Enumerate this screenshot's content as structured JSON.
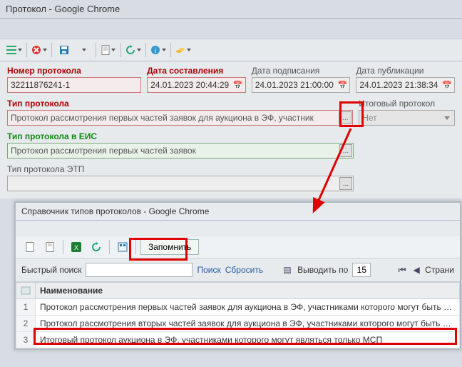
{
  "window_title": "Протокол - Google Chrome",
  "toolbar_icons": [
    "menu",
    "close",
    "save",
    "save-dd",
    "doc",
    "doc-dd",
    "refresh",
    "info",
    "info-dd",
    "coins",
    "coins-dd"
  ],
  "labels": {
    "number": "Номер протокола",
    "date_created": "Дата составления",
    "date_signed": "Дата подписания",
    "date_published": "Дата публикации",
    "type": "Тип протокола",
    "final": "Итоговый протокол",
    "type_eis": "Тип протокола в ЕИС",
    "type_etp": "Тип протокола ЭТП"
  },
  "values": {
    "number": "32211876241-1",
    "date_created": "24.01.2023 20:44:29",
    "date_signed": "24.01.2023 21:00:00",
    "date_published": "24.01.2023 21:38:34",
    "type": "Протокол рассмотрения первых частей заявок для аукциона в ЭФ, участник",
    "type_eis": "Протокол рассмотрения первых частей заявок",
    "type_etp": "",
    "final": "Нет"
  },
  "modal": {
    "title": "Справочник типов протоколов - Google Chrome",
    "remember": "Запомнить",
    "quick_search_label": "Быстрый поиск",
    "search": "Поиск",
    "reset": "Сбросить",
    "show_by": "Выводить по",
    "page_size": "15",
    "page_label": "Страни",
    "header_name": "Наименование",
    "rows": [
      {
        "n": "1",
        "name": "Протокол рассмотрения первых частей заявок для аукциона в ЭФ, участниками которого могут быть тол..."
      },
      {
        "n": "2",
        "name": "Протокол рассмотрения вторых частей заявок для аукциона в ЭФ, участниками которого могут быть тол..."
      },
      {
        "n": "3",
        "name": "Итоговый протокол аукциона в ЭФ, участниками которого могут являться только МСП"
      }
    ]
  },
  "colors": {
    "red": "#e00000",
    "green": "#128a12"
  }
}
